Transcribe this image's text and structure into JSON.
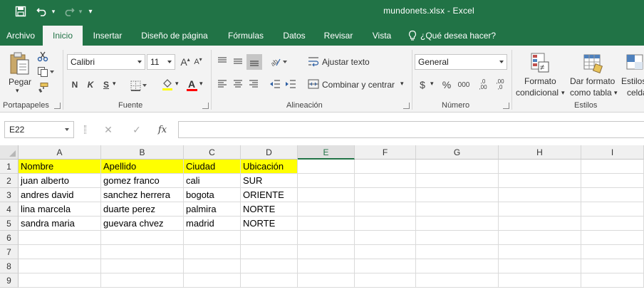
{
  "window": {
    "title": "mundonets.xlsx  -  Excel"
  },
  "quick_access": {
    "save_icon": "save-icon",
    "undo_icon": "undo-icon",
    "redo_icon": "redo-icon",
    "customize_icon": "customize-icon"
  },
  "tabs": [
    {
      "label": "Archivo"
    },
    {
      "label": "Inicio"
    },
    {
      "label": "Insertar"
    },
    {
      "label": "Diseño de página"
    },
    {
      "label": "Fórmulas"
    },
    {
      "label": "Datos"
    },
    {
      "label": "Revisar"
    },
    {
      "label": "Vista"
    }
  ],
  "tell_me": "¿Qué desea hacer?",
  "ribbon": {
    "clipboard": {
      "paste_label": "Pegar",
      "group_label": "Portapapeles"
    },
    "font": {
      "name": "Calibri",
      "size": "11",
      "bold": "N",
      "italic": "K",
      "underline": "S",
      "group_label": "Fuente",
      "grow": "A",
      "shrink": "A"
    },
    "alignment": {
      "wrap_label": "Ajustar texto",
      "merge_label": "Combinar y centrar",
      "group_label": "Alineación"
    },
    "number": {
      "format": "General",
      "currency": "$",
      "percent": "%",
      "thousands": "000",
      "inc_decimal": ",0\n,00",
      "dec_decimal": ",00\n,0",
      "group_label": "Número"
    },
    "styles": {
      "cond_format_l1": "Formato",
      "cond_format_l2": "condicional",
      "table_format_l1": "Dar formato",
      "table_format_l2": "como tabla",
      "cell_styles_l1": "Estilos",
      "cell_styles_l2": "celda",
      "group_label": "Estilos"
    }
  },
  "formula_bar": {
    "name_box": "E22",
    "cancel": "✕",
    "enter": "✓",
    "fx": "fx",
    "value": ""
  },
  "columns": [
    "A",
    "B",
    "C",
    "D",
    "E",
    "F",
    "G",
    "H",
    "I"
  ],
  "selected_column": "E",
  "rows": [
    "1",
    "2",
    "3",
    "4",
    "5",
    "6",
    "7",
    "8",
    "9"
  ],
  "table": {
    "headers": [
      "Nombre",
      "Apellido",
      "Ciudad",
      "Ubicación"
    ],
    "rows": [
      [
        "juan alberto",
        "gomez franco",
        "cali",
        "SUR"
      ],
      [
        "andres david",
        "sanchez herrera",
        "bogota",
        "ORIENTE"
      ],
      [
        "lina marcela",
        "duarte perez",
        "palmira",
        "NORTE"
      ],
      [
        "sandra maria",
        "guevara chvez",
        "madrid",
        "NORTE"
      ]
    ]
  },
  "colors": {
    "brand": "#217346",
    "header_fill": "#ffff00",
    "font_color_bar": "#ff0000"
  }
}
